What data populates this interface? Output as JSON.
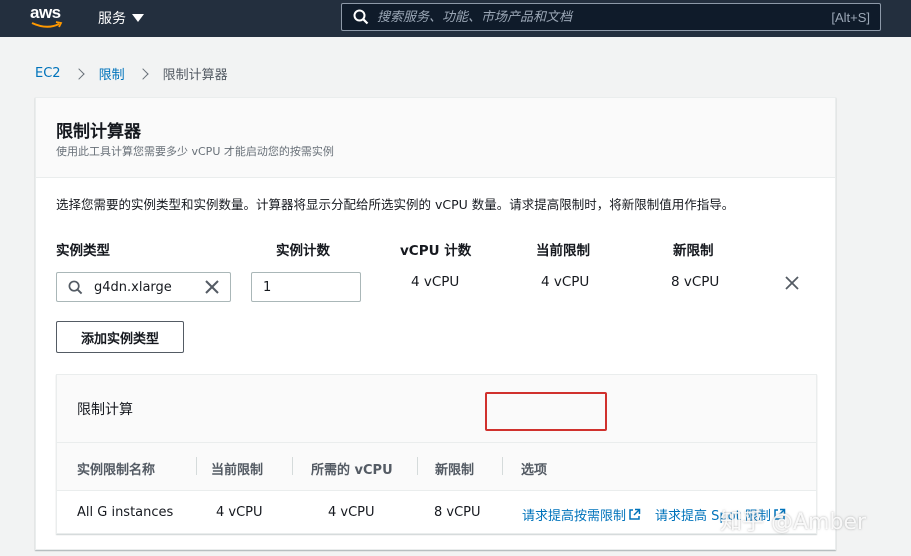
{
  "nav": {
    "logo_text": "aws",
    "services_label": "服务",
    "search_placeholder": "搜索服务、功能、市场产品和文档",
    "search_shortcut": "[Alt+S]"
  },
  "breadcrumb": {
    "items": [
      "EC2",
      "限制"
    ],
    "current": "限制计算器"
  },
  "calculator": {
    "title": "限制计算器",
    "subtitle": "使用此工具计算您需要多少 vCPU 才能启动您的按需实例",
    "intro": "选择您需要的实例类型和实例数量。计算器将显示分配给所选实例的 vCPU 数量。请求提高限制时，将新限制值用作指导。",
    "columns": [
      "实例类型",
      "实例计数",
      "vCPU 计数",
      "当前限制",
      "新限制"
    ],
    "row": {
      "instance_type": "g4dn.xlarge",
      "instance_count": "1",
      "vcpu_count": "4 vCPU",
      "current_limit": "4 vCPU",
      "new_limit": "8 vCPU"
    },
    "add_button_label": "添加实例类型"
  },
  "limit_calc": {
    "title": "限制计算",
    "columns": [
      "实例限制名称",
      "当前限制",
      "所需的 vCPU",
      "新限制",
      "选项"
    ],
    "row": {
      "name": "All G instances",
      "current_limit": "4 vCPU",
      "required_vcpu": "4 vCPU",
      "new_limit": "8 vCPU",
      "option_on_demand": "请求提高按需限制",
      "option_spot": "请求提高 Spot 限制"
    }
  },
  "watermark": "知乎 @Amber",
  "colors": {
    "nav_bg": "#232f3e",
    "link": "#0073bb",
    "highlight": "#d0312d"
  }
}
